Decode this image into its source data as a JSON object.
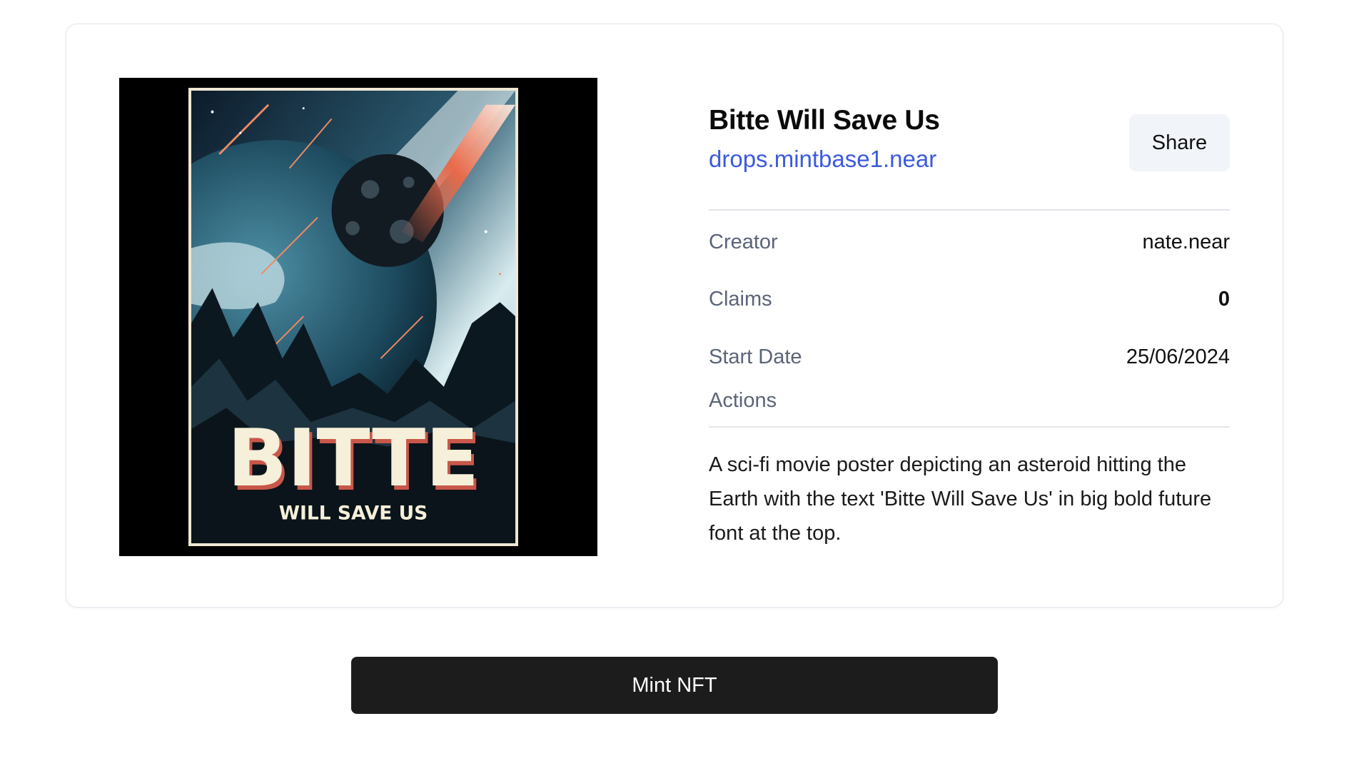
{
  "nft": {
    "title": "Bitte Will Save Us",
    "contract": "drops.mintbase1.near",
    "share_label": "Share",
    "poster_alt": "asteroid-poster-image"
  },
  "meta": {
    "creator_label": "Creator",
    "creator_value": "nate.near",
    "claims_label": "Claims",
    "claims_value": "0",
    "start_date_label": "Start Date",
    "start_date_value": "25/06/2024",
    "actions_label": "Actions"
  },
  "description": "A sci-fi movie poster depicting an asteroid hitting the Earth with the text 'Bitte Will Save Us' in big bold future font at the top.",
  "poster_text": {
    "big": "BITTE",
    "sub": "WILL SAVE US"
  },
  "mint": {
    "label": "Mint NFT"
  },
  "colors": {
    "link": "#3b5bdb",
    "mint_bg": "#1c1c1c",
    "share_bg": "#f1f4f9"
  }
}
